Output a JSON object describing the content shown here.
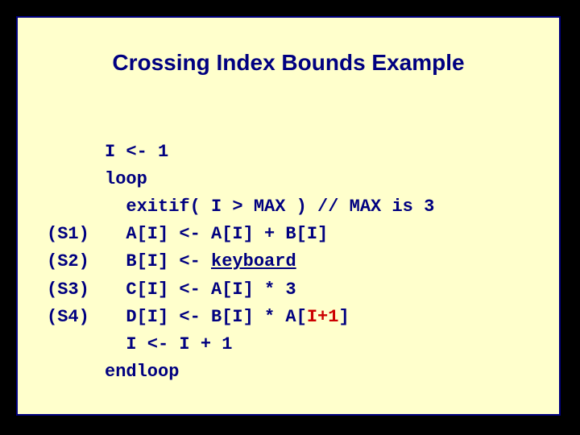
{
  "title": "Crossing Index Bounds Example",
  "labels": {
    "s1": "(S1)",
    "s2": "(S2)",
    "s3": "(S3)",
    "s4": "(S4)"
  },
  "code": {
    "l1": "I <- 1",
    "l2": "loop",
    "l3": "  exitif( I > MAX ) // MAX is 3",
    "l4": "  A[I] <- A[I] + B[I]",
    "l5_pre": "  B[I] <- ",
    "l5_kb": "keyboard",
    "l6": "  C[I] <- A[I] * 3",
    "l7_pre": "  D[I] <- B[I] * A[",
    "l7_idx": "I+1",
    "l7_post": "]",
    "l8": "  I <- I + 1",
    "l9": "endloop"
  }
}
